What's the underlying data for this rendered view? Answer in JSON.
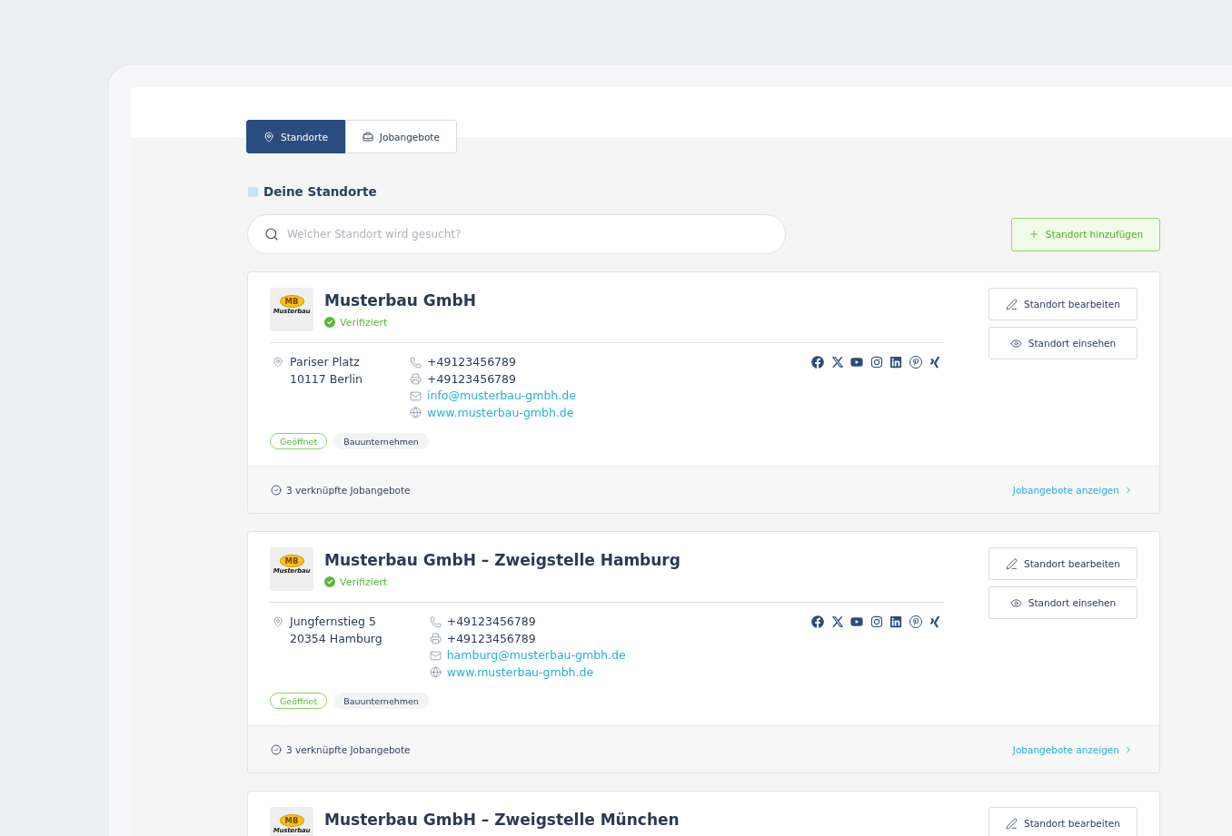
{
  "tabs": [
    {
      "label": "Standorte",
      "selected": true
    },
    {
      "label": "Jobangebote",
      "selected": false
    }
  ],
  "section": {
    "title": "Deine Standorte"
  },
  "search": {
    "placeholder": "Welcher Standort wird gesucht?"
  },
  "add_button": {
    "label": "Standort hinzufügen"
  },
  "locations": [
    {
      "logo": {
        "badge": "MB",
        "name": "Musterbau"
      },
      "title": "Musterbau GmbH",
      "verification": "Verifiziert",
      "address": [
        "Pariser Platz",
        "10117 Berlin"
      ],
      "contacts": [
        {
          "kind": "phone",
          "text": "+49123456789"
        },
        {
          "kind": "fax",
          "text": "+49123456789"
        },
        {
          "kind": "email",
          "text": "info@musterbau-gmbh.de"
        },
        {
          "kind": "website",
          "text": "www.musterbau-gmbh.de"
        }
      ],
      "tags": [
        {
          "kind": "status",
          "label": "Geöffnet"
        },
        {
          "kind": "category",
          "label": "Bauunternehmen"
        }
      ],
      "actions": [
        {
          "kind": "edit",
          "label": "Standort bearbeiten"
        },
        {
          "kind": "view",
          "label": "Standort einsehen"
        }
      ],
      "footer": {
        "count": "3 verknüpfte Jobangebote",
        "link": "Jobangebote anzeigen"
      }
    },
    {
      "logo": {
        "badge": "MB",
        "name": "Musterbau"
      },
      "title": "Musterbau GmbH – Zweigstelle Hamburg",
      "verification": "Verifiziert",
      "address": [
        "Jungfernstieg 5",
        "20354 Hamburg"
      ],
      "contacts": [
        {
          "kind": "phone",
          "text": "+49123456789"
        },
        {
          "kind": "fax",
          "text": "+49123456789"
        },
        {
          "kind": "email",
          "text": "hamburg@musterbau-gmbh.de"
        },
        {
          "kind": "website",
          "text": "www.musterbau-gmbh.de"
        }
      ],
      "tags": [
        {
          "kind": "status",
          "label": "Geöffnet"
        },
        {
          "kind": "category",
          "label": "Bauunternehmen"
        }
      ],
      "actions": [
        {
          "kind": "edit",
          "label": "Standort bearbeiten"
        },
        {
          "kind": "view",
          "label": "Standort einsehen"
        }
      ],
      "footer": {
        "count": "3 verknüpfte Jobangebote",
        "link": "Jobangebote anzeigen"
      }
    },
    {
      "logo": {
        "badge": "MB",
        "name": "Musterbau"
      },
      "title": "Musterbau GmbH – Zweigstelle München",
      "actions": [
        {
          "kind": "edit",
          "label": "Standort bearbeiten"
        }
      ]
    }
  ]
}
